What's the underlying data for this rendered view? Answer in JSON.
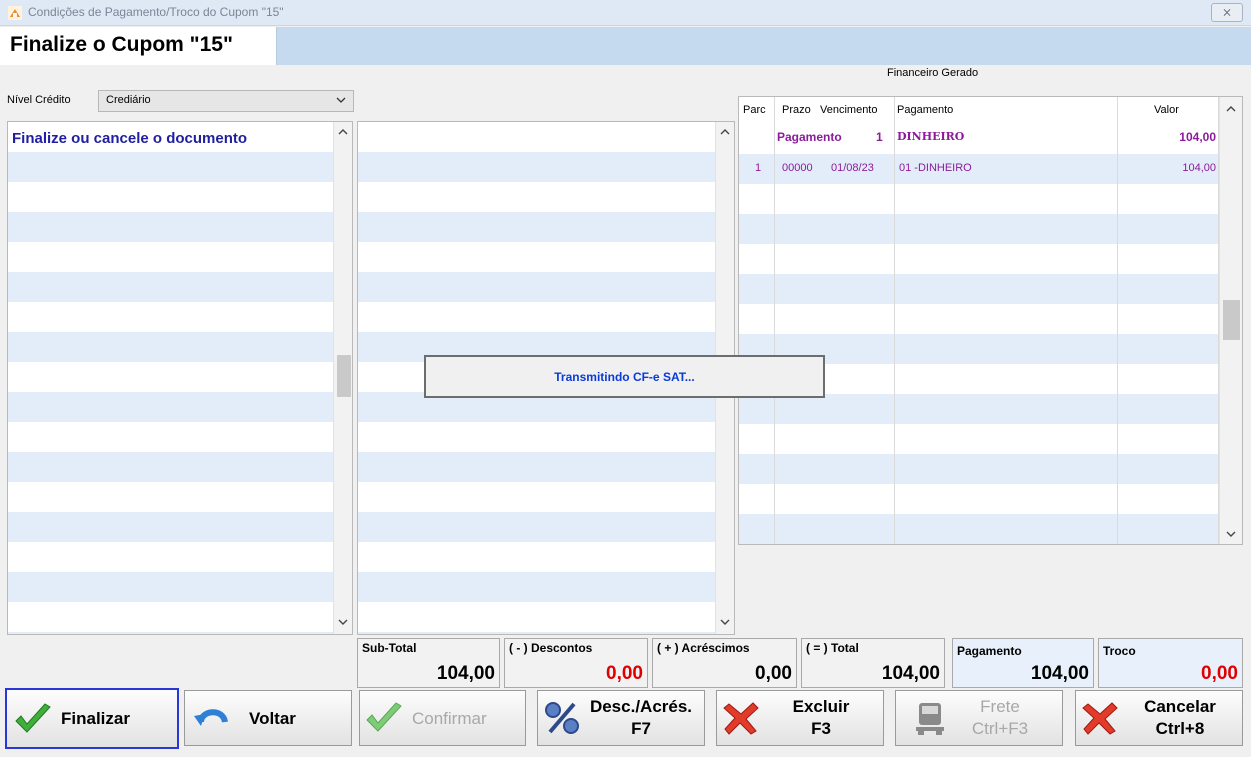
{
  "window": {
    "title": "Condições de Pagamento/Troco do Cupom \"15\"",
    "close_glyph": "⨯"
  },
  "header": {
    "title": "Finalize o Cupom \"15\""
  },
  "nivel_credito": {
    "label": "Nível Crédito",
    "value": "Crediário"
  },
  "left_pane": {
    "message": "Finalize ou cancele o documento"
  },
  "financeiro": {
    "label": "Financeiro Gerado",
    "columns": [
      "Parc",
      "Prazo",
      "Vencimento",
      "Pagamento",
      "Valor"
    ],
    "group_row": {
      "label": "Pagamento",
      "number": "1",
      "pagamento": "DINHEIRO",
      "valor": "104,00"
    },
    "rows": [
      {
        "parc": "1",
        "prazo": "00000",
        "vencimento": "01/08/23",
        "pagamento": "01 -DINHEIRO",
        "valor": "104,00"
      }
    ]
  },
  "totals": {
    "subtotal": {
      "label": "Sub-Total",
      "value": "104,00"
    },
    "descontos": {
      "label": "( - ) Descontos",
      "value": "0,00"
    },
    "acrescimos": {
      "label": "( + ) Acréscimos",
      "value": "0,00"
    },
    "total": {
      "label": "( = ) Total",
      "value": "104,00"
    },
    "pagamento": {
      "label": "Pagamento",
      "value": "104,00"
    },
    "troco": {
      "label": "Troco",
      "value": "0,00"
    }
  },
  "buttons": {
    "finalizar": "Finalizar",
    "voltar": "Voltar",
    "confirmar": "Confirmar",
    "desc_acres": {
      "line1": "Desc./Acrés.",
      "line2": "F7"
    },
    "excluir": {
      "line1": "Excluir",
      "line2": "F3"
    },
    "frete": {
      "line1": "Frete",
      "line2": "Ctrl+F3"
    },
    "cancelar": {
      "line1": "Cancelar",
      "line2": "Ctrl+8"
    }
  },
  "overlay": {
    "message": "Transmitindo CF-e SAT..."
  },
  "icons": {
    "app": "app-icon",
    "check": "check-icon",
    "undo": "undo-arrow-icon",
    "percent": "percent-icon",
    "delete": "red-x-icon",
    "truck": "truck-icon"
  },
  "colors": {
    "accent_purple": "#8b1b9b",
    "message_blue": "#1f1fa0",
    "overlay_text": "#0a3bd6",
    "red_value": "#e00000",
    "focus_border": "#2a37d8"
  }
}
